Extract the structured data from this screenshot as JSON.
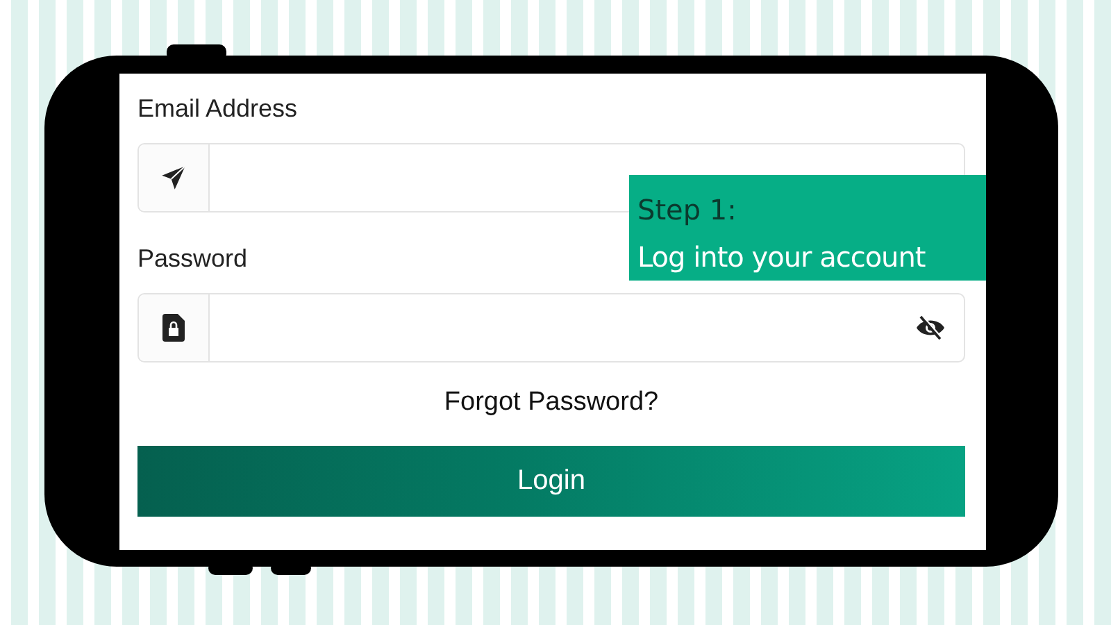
{
  "form": {
    "fields": [
      {
        "kind": "email",
        "label": "Email Address"
      },
      {
        "kind": "password",
        "label": "Password",
        "password_visible": false
      }
    ],
    "forgot_link": "Forgot Password?",
    "submit_button": "Login"
  },
  "callout": {
    "title": "Step 1:",
    "text": "Log into your account"
  }
}
